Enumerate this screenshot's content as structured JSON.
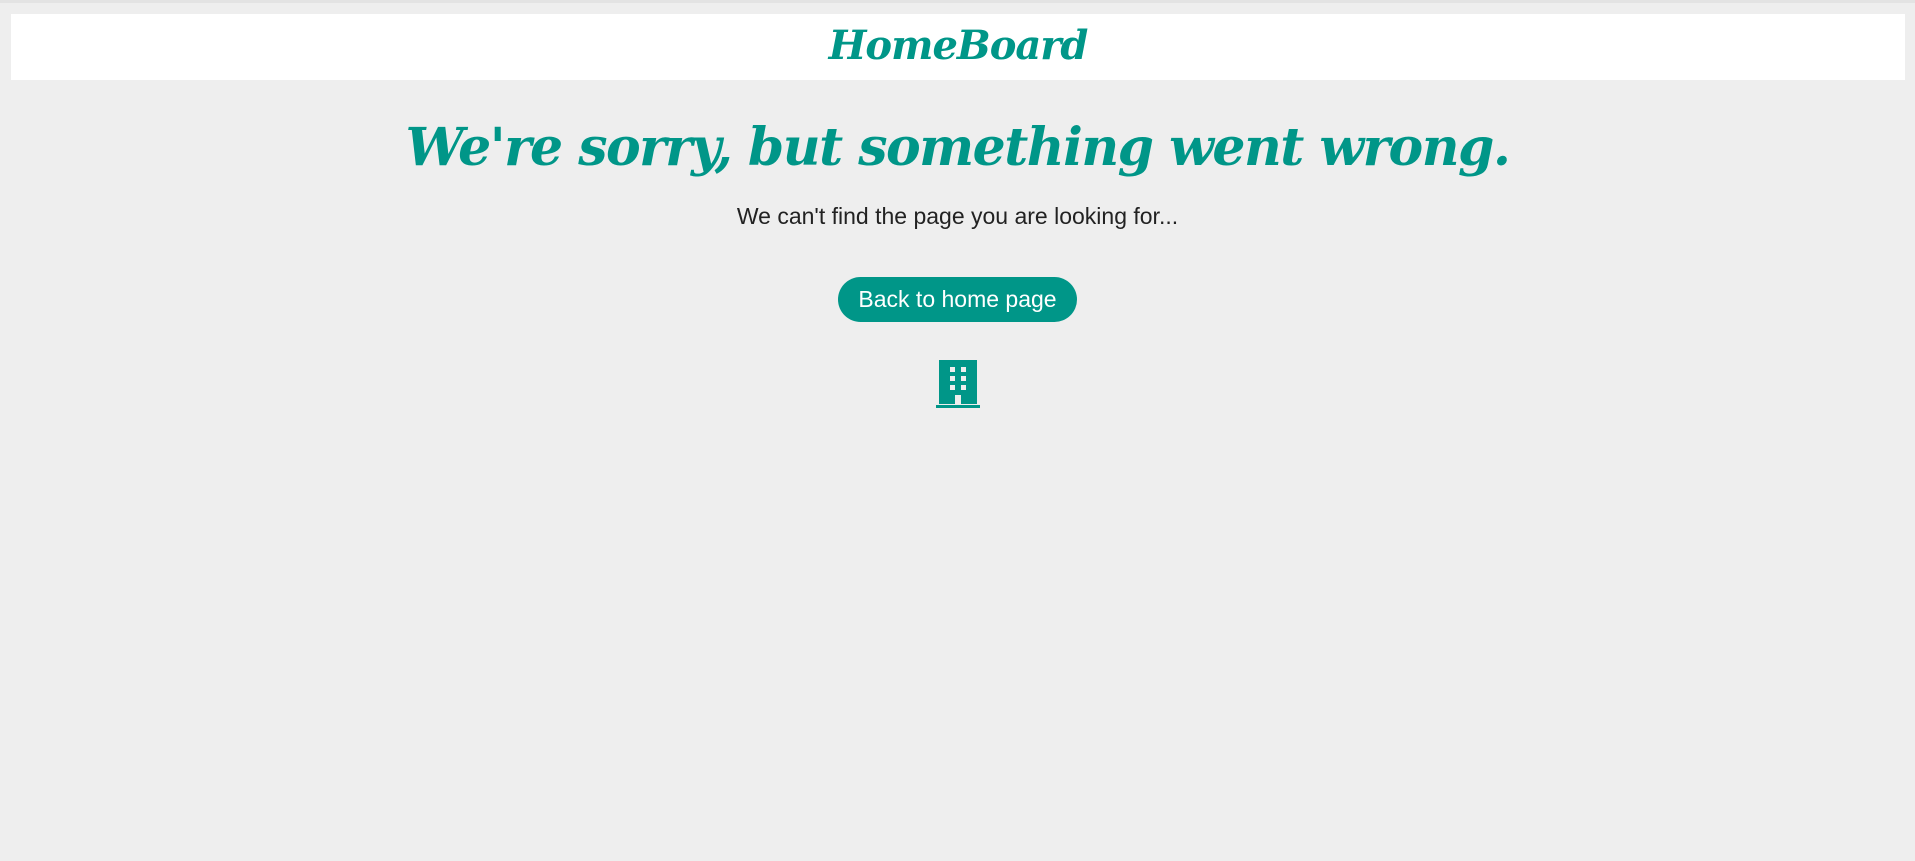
{
  "header": {
    "logo_text": "HomeBoard"
  },
  "error": {
    "title": "We're sorry, but something went wrong.",
    "message": "We can't find the page you are looking for...",
    "button_label": "Back to home page",
    "icon": "building-icon"
  },
  "colors": {
    "accent": "#009688",
    "background": "#eeeeee",
    "header_background": "#ffffff",
    "text": "#222222"
  }
}
